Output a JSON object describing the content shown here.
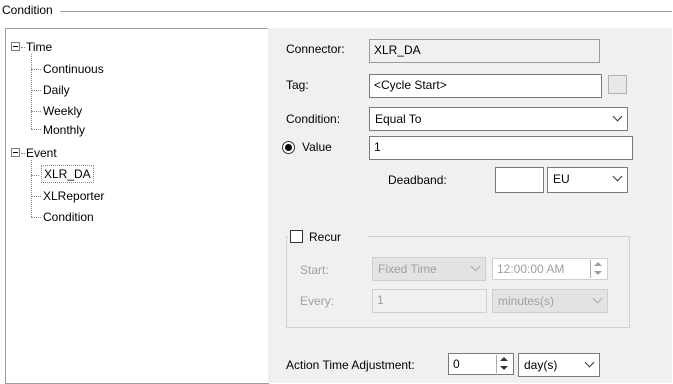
{
  "group": {
    "title": "Condition"
  },
  "tree": {
    "time": {
      "label": "Time",
      "children": [
        "Continuous",
        "Daily",
        "Weekly",
        "Monthly"
      ]
    },
    "event": {
      "label": "Event",
      "children": [
        "XLR_DA",
        "XLReporter",
        "Condition"
      ]
    }
  },
  "form": {
    "connector": {
      "label": "Connector:",
      "value": "XLR_DA"
    },
    "tag": {
      "label": "Tag:",
      "value": "<Cycle Start>"
    },
    "condition": {
      "label": "Condition:",
      "value": "Equal To"
    },
    "value_radio": {
      "label": "Value",
      "value": "1",
      "selected": true
    },
    "deadband": {
      "label": "Deadband:",
      "value": "",
      "unit": "EU"
    },
    "recur": {
      "label": "Recur",
      "checked": false,
      "start_label": "Start:",
      "start_mode": "Fixed Time",
      "start_time": "12:00:00 AM",
      "every_label": "Every:",
      "every_value": "1",
      "every_unit": "minutes(s)"
    },
    "action_adjust": {
      "label": "Action Time Adjustment:",
      "value": "0",
      "unit": "day(s)"
    }
  }
}
